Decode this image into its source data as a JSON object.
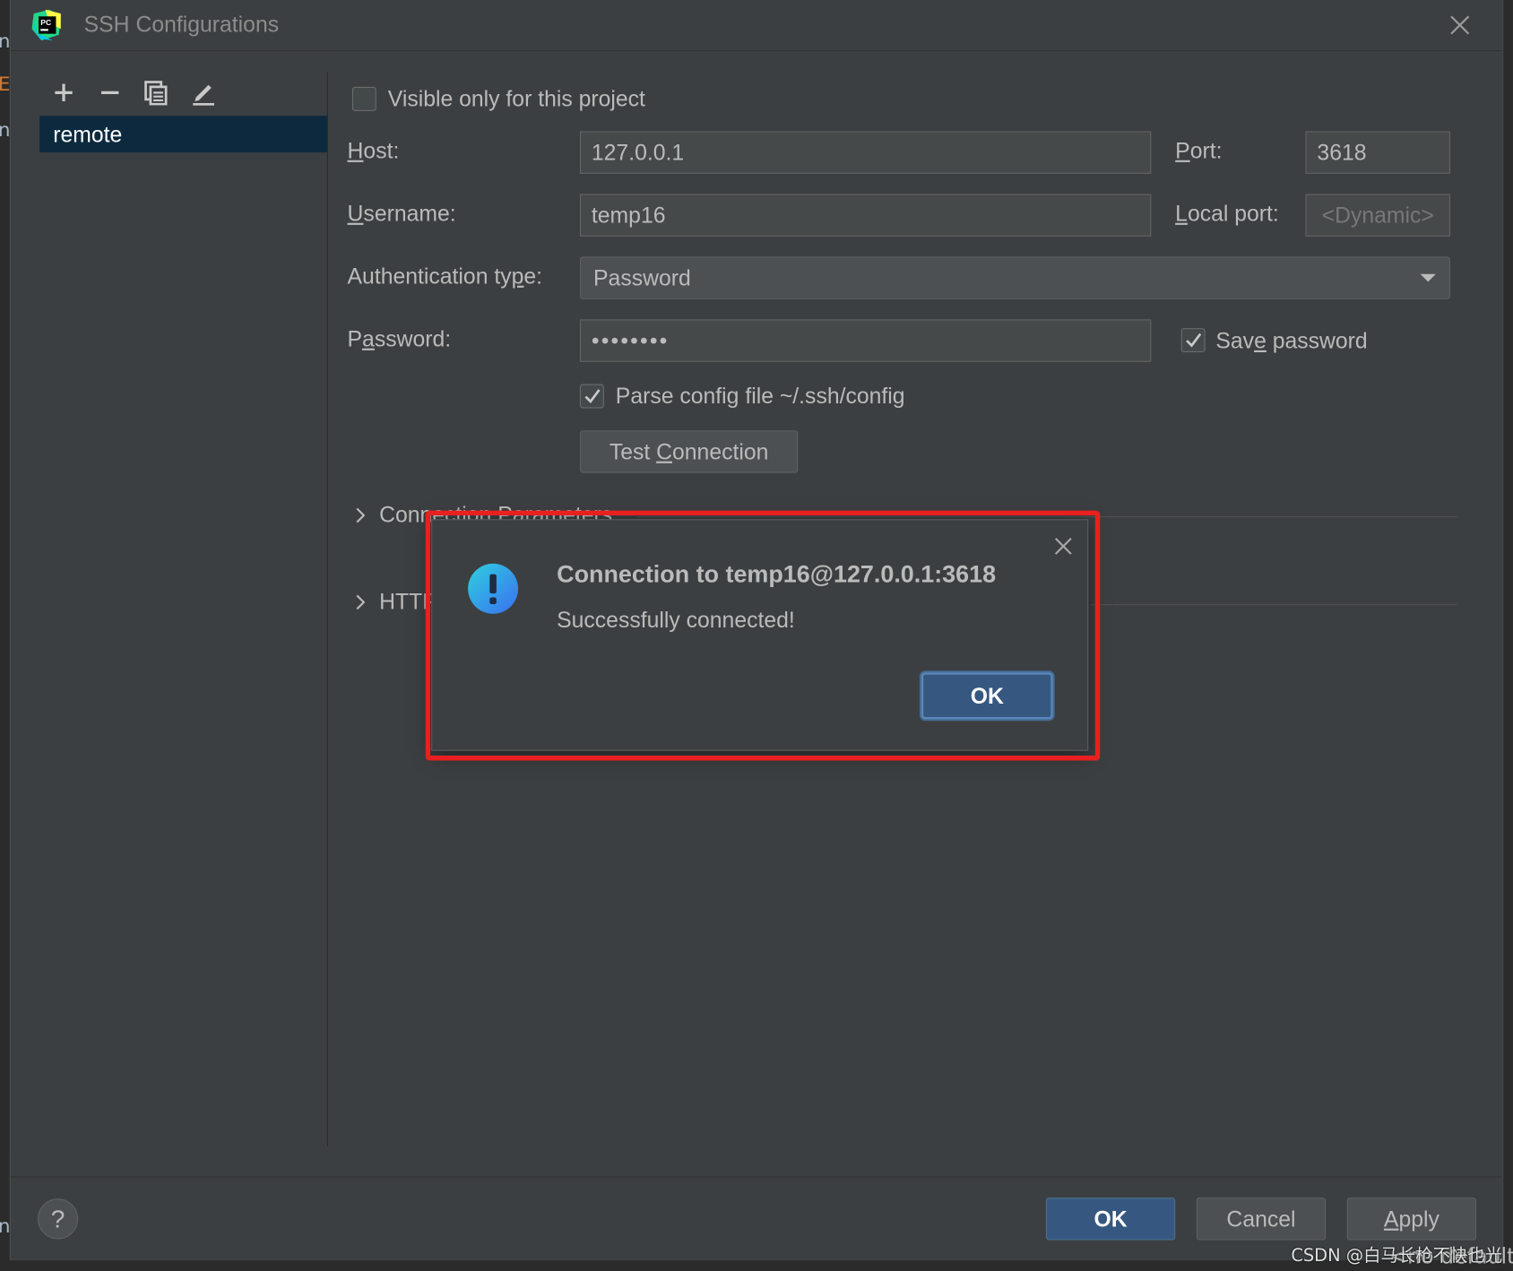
{
  "window": {
    "title": "SSH Configurations"
  },
  "editor": {
    "fragments": [
      "n",
      "E",
      "n",
      "n"
    ]
  },
  "sidebar": {
    "items": [
      {
        "label": "remote"
      }
    ]
  },
  "form": {
    "visible_only_label": "Visible only for this project",
    "visible_only_checked": false,
    "host_label_u": "H",
    "host_label_rest": "ost:",
    "host_value": "127.0.0.1",
    "port_label_u": "P",
    "port_label_rest": "ort:",
    "port_value": "3618",
    "username_label_u": "U",
    "username_label_rest": "sername:",
    "username_value": "temp16",
    "local_port_label_u": "L",
    "local_port_label_rest": "ocal port:",
    "local_port_placeholder": "<Dynamic>",
    "auth_label_pre": "Authentication ty",
    "auth_label_u": "p",
    "auth_label_post": "e:",
    "auth_value": "Password",
    "password_label_pre": "P",
    "password_label_u": "a",
    "password_label_post": "ssword:",
    "password_value": "••••••••",
    "save_password_pre": "Sav",
    "save_password_u": "e",
    "save_password_post": " password",
    "save_password_checked": true,
    "parse_config_label": "Parse config file ~/.ssh/config",
    "parse_config_checked": true,
    "test_connection_pre": "Test ",
    "test_connection_u": "C",
    "test_connection_post": "onnection"
  },
  "sections": [
    {
      "label": "Connection Parameters"
    },
    {
      "label": "HTTP"
    }
  ],
  "dialog": {
    "title": "Connection to temp16@127.0.0.1:3618",
    "message": "Successfully connected!",
    "ok_label": "OK",
    "icon": "info-icon"
  },
  "footer": {
    "help_label": "?",
    "ok_label": "OK",
    "cancel_label": "Cancel",
    "apply_pre": "",
    "apply_u": "A",
    "apply_post": "pply"
  },
  "overlay_text": {
    "watermark": "CSDN @白马长枪不快也光",
    "behind_text": "<no default s"
  },
  "colors": {
    "highlight": "#e8201f",
    "primary_button": "#365880",
    "selection": "#0d293e"
  }
}
